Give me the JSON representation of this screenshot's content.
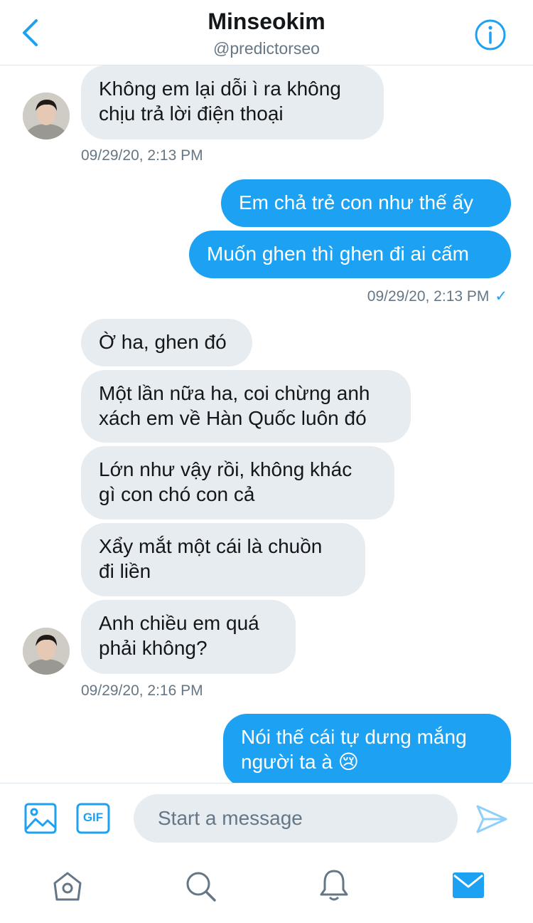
{
  "header": {
    "title": "Minseokim",
    "handle": "@predictorseo"
  },
  "messages": [
    {
      "side": "in",
      "text": "Không em lại dỗi ì ra không\nchịu trả lời điện thoại"
    },
    {
      "side": "in_time",
      "text": "09/29/20, 2:13 PM"
    },
    {
      "side": "out",
      "text": "Em chả trẻ con như thế ấy"
    },
    {
      "side": "out",
      "text": "Muốn ghen thì ghen đi ai cấm"
    },
    {
      "side": "out_time",
      "text": "09/29/20, 2:13 PM",
      "check": "✓"
    },
    {
      "side": "in",
      "text": "Ờ ha, ghen đó"
    },
    {
      "side": "in",
      "text": "Một lần nữa ha, coi chừng anh\nxách em về Hàn Quốc luôn đó"
    },
    {
      "side": "in",
      "text": "Lớn như vậy rồi, không khác\ngì con chó con cả"
    },
    {
      "side": "in",
      "text": "Xẩy mắt một cái là chuồn\nđi liền"
    },
    {
      "side": "in",
      "text": "Anh chiều em quá\nphải không?"
    },
    {
      "side": "in_time",
      "text": "09/29/20, 2:16 PM"
    },
    {
      "side": "out",
      "text": "Nói thế cái tự dưng mắng\nngười ta à 😢"
    }
  ],
  "composer": {
    "placeholder": "Start a message",
    "gif_label": "GIF"
  },
  "icons": {
    "back": "chevron-left-icon",
    "info": "info-icon",
    "image": "image-icon",
    "gif": "gif-icon",
    "send": "send-icon",
    "home": "home-icon",
    "search": "search-icon",
    "notifications": "bell-icon",
    "messages": "mail-icon"
  },
  "colors": {
    "accent": "#1da1f2",
    "incoming_bubble": "#e6ecf0",
    "secondary_text": "#657786",
    "send_disabled": "#8ed0f9"
  }
}
